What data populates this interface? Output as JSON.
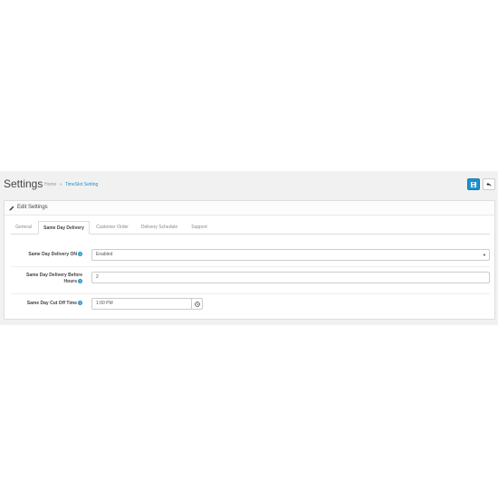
{
  "header": {
    "title": "Settings",
    "breadcrumb": [
      {
        "label": "Home"
      },
      {
        "label": "TimeSlot Setting"
      }
    ],
    "breadcrumb_separator": "»"
  },
  "panel": {
    "title": "Edit Settings"
  },
  "tabs": [
    {
      "label": "General",
      "active": false
    },
    {
      "label": "Same Day Delivery",
      "active": true
    },
    {
      "label": "Customer Order",
      "active": false
    },
    {
      "label": "Delivery Schedule",
      "active": false
    },
    {
      "label": "Support",
      "active": false
    }
  ],
  "form": {
    "same_day_on": {
      "label": "Same Day Delivery ON",
      "value": "Enabled"
    },
    "before_hours": {
      "label_line1": "Same Day Delivery Before",
      "label_line2": "Hours",
      "value": "2"
    },
    "cut_off": {
      "label": "Same Day Cut Off Time",
      "value": "1:00 PM"
    }
  },
  "colors": {
    "primary": "#1e91cf",
    "background": "#f1f1f1"
  },
  "icons": {
    "save": "save-icon",
    "back": "reply-icon",
    "edit": "pencil-icon",
    "help": "question-circle-icon",
    "time": "clock-icon",
    "dropdown": "caret-down-icon"
  }
}
